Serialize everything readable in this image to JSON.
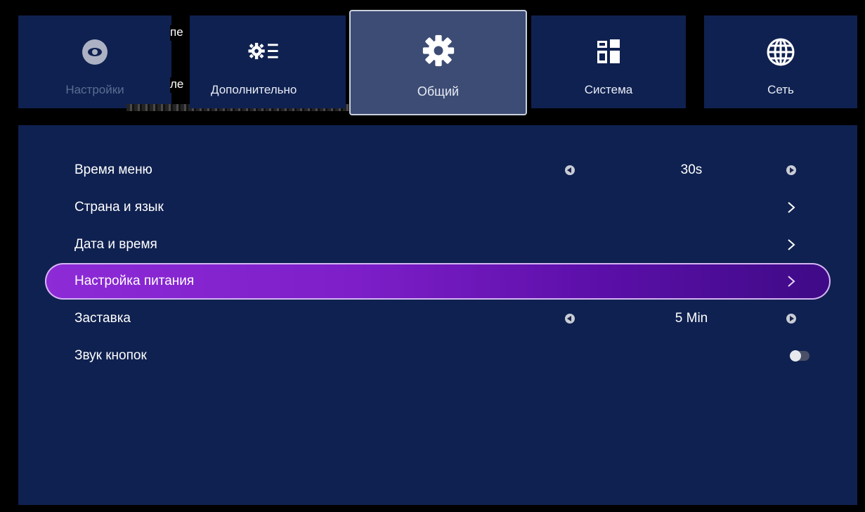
{
  "tabs": [
    {
      "id": "settings",
      "label": "Настройки",
      "icon": "eye-icon"
    },
    {
      "id": "advanced",
      "label": "Дополнительно",
      "icon": "gear-list-icon"
    },
    {
      "id": "general",
      "label": "Общий",
      "icon": "gear-icon",
      "active": true
    },
    {
      "id": "system",
      "label": "Система",
      "icon": "windows-grid-icon"
    },
    {
      "id": "network",
      "label": "Сеть",
      "icon": "globe-icon"
    }
  ],
  "overlay": {
    "fragment_top": "пе",
    "fragment_bottom": "ле"
  },
  "menu": {
    "items": [
      {
        "label": "Время меню",
        "value": "30s",
        "control": "stepper"
      },
      {
        "label": "Страна и язык",
        "control": "submenu"
      },
      {
        "label": "Дата и время",
        "control": "submenu"
      },
      {
        "label": "Настройка питания",
        "control": "submenu",
        "selected": true
      },
      {
        "label": "Заставка",
        "value": "5 Min",
        "control": "stepper"
      },
      {
        "label": "Звук кнопок",
        "control": "toggle",
        "toggle_on": false
      }
    ]
  },
  "colors": {
    "background": "#000000",
    "panel": "#0f2150",
    "active_tab": "#3d4c74",
    "highlight_start": "#8d2bd7",
    "highlight_end": "#3e0a86"
  }
}
